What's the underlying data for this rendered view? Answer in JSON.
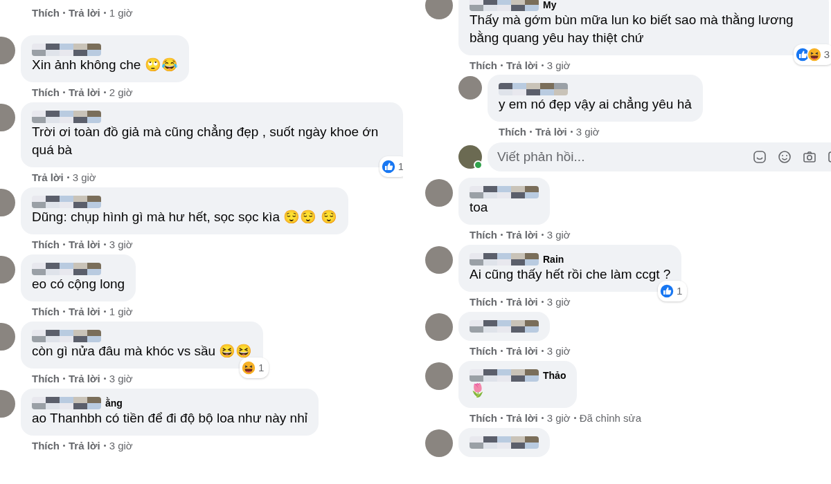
{
  "columns": [
    {
      "comments": [
        {
          "actions": [
            {
              "text": "Thích",
              "kind": "link"
            },
            {
              "text": "Trả lời",
              "kind": "link"
            },
            {
              "text": "1 giờ",
              "kind": "time"
            }
          ]
        },
        {
          "mosaic": true,
          "text": "Xin ảnh không che 🙄😂",
          "actions": [
            {
              "text": "Thích",
              "kind": "link"
            },
            {
              "text": "Trả lời",
              "kind": "link"
            },
            {
              "text": "2 giờ",
              "kind": "time"
            }
          ]
        },
        {
          "mosaic": true,
          "text": "Trời ơi toàn đồ giả mà cũng chẳng đẹp , suốt ngày khoe ớn quá bà",
          "reactions": {
            "like": true,
            "count": "1"
          },
          "actions": [
            {
              "text": "Trả lời",
              "kind": "link"
            },
            {
              "text": "3 giờ",
              "kind": "time"
            }
          ]
        },
        {
          "mosaic": true,
          "text": "Dũng: chụp hình gì mà hư hết, sọc sọc kìa 😌😌 😌",
          "actions": [
            {
              "text": "Thích",
              "kind": "link"
            },
            {
              "text": "Trả lời",
              "kind": "link"
            },
            {
              "text": "3 giờ",
              "kind": "time"
            }
          ]
        },
        {
          "mosaic": true,
          "text": "eo có cộng long",
          "actions": [
            {
              "text": "Thích",
              "kind": "link"
            },
            {
              "text": "Trả lời",
              "kind": "link"
            },
            {
              "text": "1 giờ",
              "kind": "time"
            }
          ]
        },
        {
          "mosaic": true,
          "text": "còn gì nửa đâu mà khóc vs sầu 😆😆",
          "reactions": {
            "haha": true,
            "count": "1"
          },
          "actions": [
            {
              "text": "Thích",
              "kind": "link"
            },
            {
              "text": "Trả lời",
              "kind": "link"
            },
            {
              "text": "3 giờ",
              "kind": "time"
            }
          ]
        },
        {
          "mosaic": true,
          "name": "ằng",
          "text": "ao Thanhbh có tiền để đi độ bộ loa như này nhỉ",
          "actions": [
            {
              "text": "Thích",
              "kind": "link"
            },
            {
              "text": "Trả lời",
              "kind": "link"
            },
            {
              "text": "3 giờ",
              "kind": "time"
            }
          ]
        }
      ]
    },
    {
      "comments": [
        {
          "mosaic": true,
          "name": "My",
          "text": "Thấy mà gớm bùn mữa lun ko biết sao mà thằng lương bằng quang yêu hay thiệt chứ",
          "reactions": {
            "like": true,
            "haha": true,
            "count": "3"
          },
          "actions": [
            {
              "text": "Thích",
              "kind": "link"
            },
            {
              "text": "Trả lời",
              "kind": "link"
            },
            {
              "text": "3 giờ",
              "kind": "time"
            }
          ],
          "replies": [
            {
              "mosaic": true,
              "text": "y em nó đẹp vậy ai chẳng yêu hả",
              "actions": [
                {
                  "text": "Thích",
                  "kind": "link"
                },
                {
                  "text": "Trả lời",
                  "kind": "link"
                },
                {
                  "text": "3 giờ",
                  "kind": "time"
                }
              ]
            }
          ],
          "reply_box": {
            "placeholder": "Viết phản hồi...",
            "online": true
          }
        },
        {
          "mosaic": true,
          "text": "toa",
          "actions": [
            {
              "text": "Thích",
              "kind": "link"
            },
            {
              "text": "Trả lời",
              "kind": "link"
            },
            {
              "text": "3 giờ",
              "kind": "time"
            }
          ]
        },
        {
          "mosaic": true,
          "name": "Rain",
          "text": "Ai cũng thấy hết rồi che làm ccgt ?",
          "reactions": {
            "like": true,
            "count": "1"
          },
          "actions": [
            {
              "text": "Thích",
              "kind": "link"
            },
            {
              "text": "Trả lời",
              "kind": "link"
            },
            {
              "text": "3 giờ",
              "kind": "time"
            }
          ]
        },
        {
          "mosaic": true,
          "actions": [
            {
              "text": "Thích",
              "kind": "link"
            },
            {
              "text": "Trả lời",
              "kind": "link"
            },
            {
              "text": "3 giờ",
              "kind": "time"
            }
          ]
        },
        {
          "mosaic": true,
          "name": "Thảo",
          "text": "🌷",
          "actions": [
            {
              "text": "Thích",
              "kind": "link"
            },
            {
              "text": "Trả lời",
              "kind": "link"
            },
            {
              "text": "3 giờ",
              "kind": "time"
            },
            {
              "text": "Đã chỉnh sửa",
              "kind": "note"
            }
          ]
        },
        {
          "mosaic": true
        }
      ]
    }
  ]
}
